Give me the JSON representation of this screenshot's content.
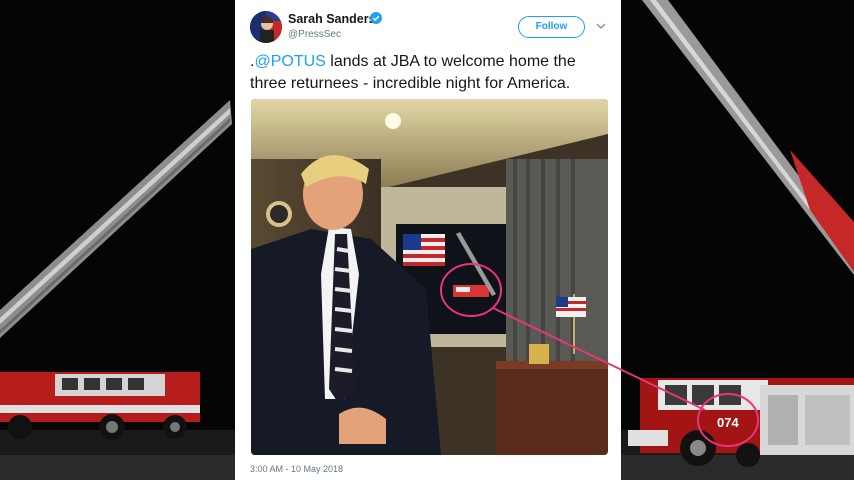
{
  "tweet": {
    "author_name": "Sarah Sanders",
    "author_handle": "@PressSec",
    "follow_label": "Follow",
    "text_prefix": ".",
    "mention": "@POTUS",
    "text_body": " lands at JBA to welcome home the three returnees - incredible night for America.",
    "timestamp": "3:00 AM - 10 May 2018"
  },
  "fire_truck": {
    "number": "074"
  },
  "icons": {
    "verified": "verified-badge-icon",
    "chevron": "chevron-down-icon"
  },
  "colors": {
    "twitter_blue": "#1da1f2",
    "annotation_pink": "#e8357a",
    "text_dark": "#14171a",
    "text_gray": "#657786"
  }
}
